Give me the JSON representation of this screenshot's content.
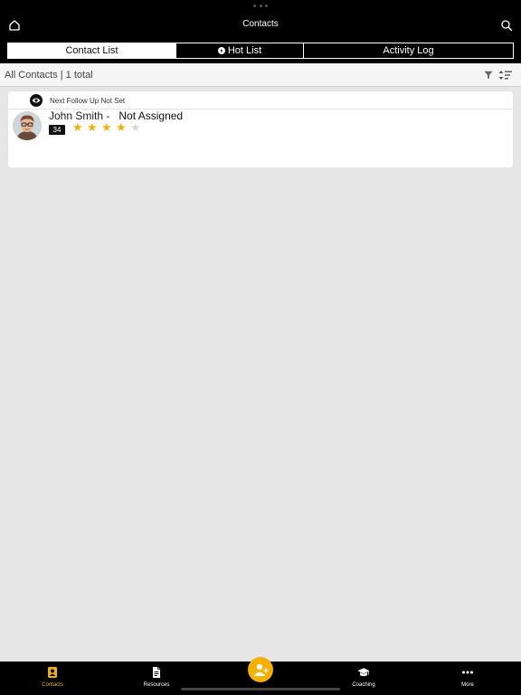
{
  "header": {
    "title": "Contacts"
  },
  "segments": [
    {
      "label": "Contact List",
      "active": true
    },
    {
      "label": "Hot List",
      "active": false
    },
    {
      "label": "Activity Log",
      "active": false
    }
  ],
  "list": {
    "summary": "All Contacts | 1 total"
  },
  "contacts": [
    {
      "follow_up": "Next Follow Up Not Set",
      "name": "John Smith -",
      "assignment": "Not Assigned",
      "score": "34",
      "rating": 4,
      "rating_max": 5
    }
  ],
  "tabs": [
    {
      "label": "Contacts",
      "icon": "contacts-icon",
      "active": true
    },
    {
      "label": "Resources",
      "icon": "document-icon",
      "active": false
    },
    {
      "label": "Coaching",
      "icon": "graduation-cap-icon",
      "active": false
    },
    {
      "label": "More",
      "icon": "more-dots-icon",
      "active": false
    }
  ],
  "colors": {
    "accent": "#f5b000",
    "bar": "#000000",
    "background": "#e6e6e6",
    "star_empty": "#d8d8d8"
  }
}
